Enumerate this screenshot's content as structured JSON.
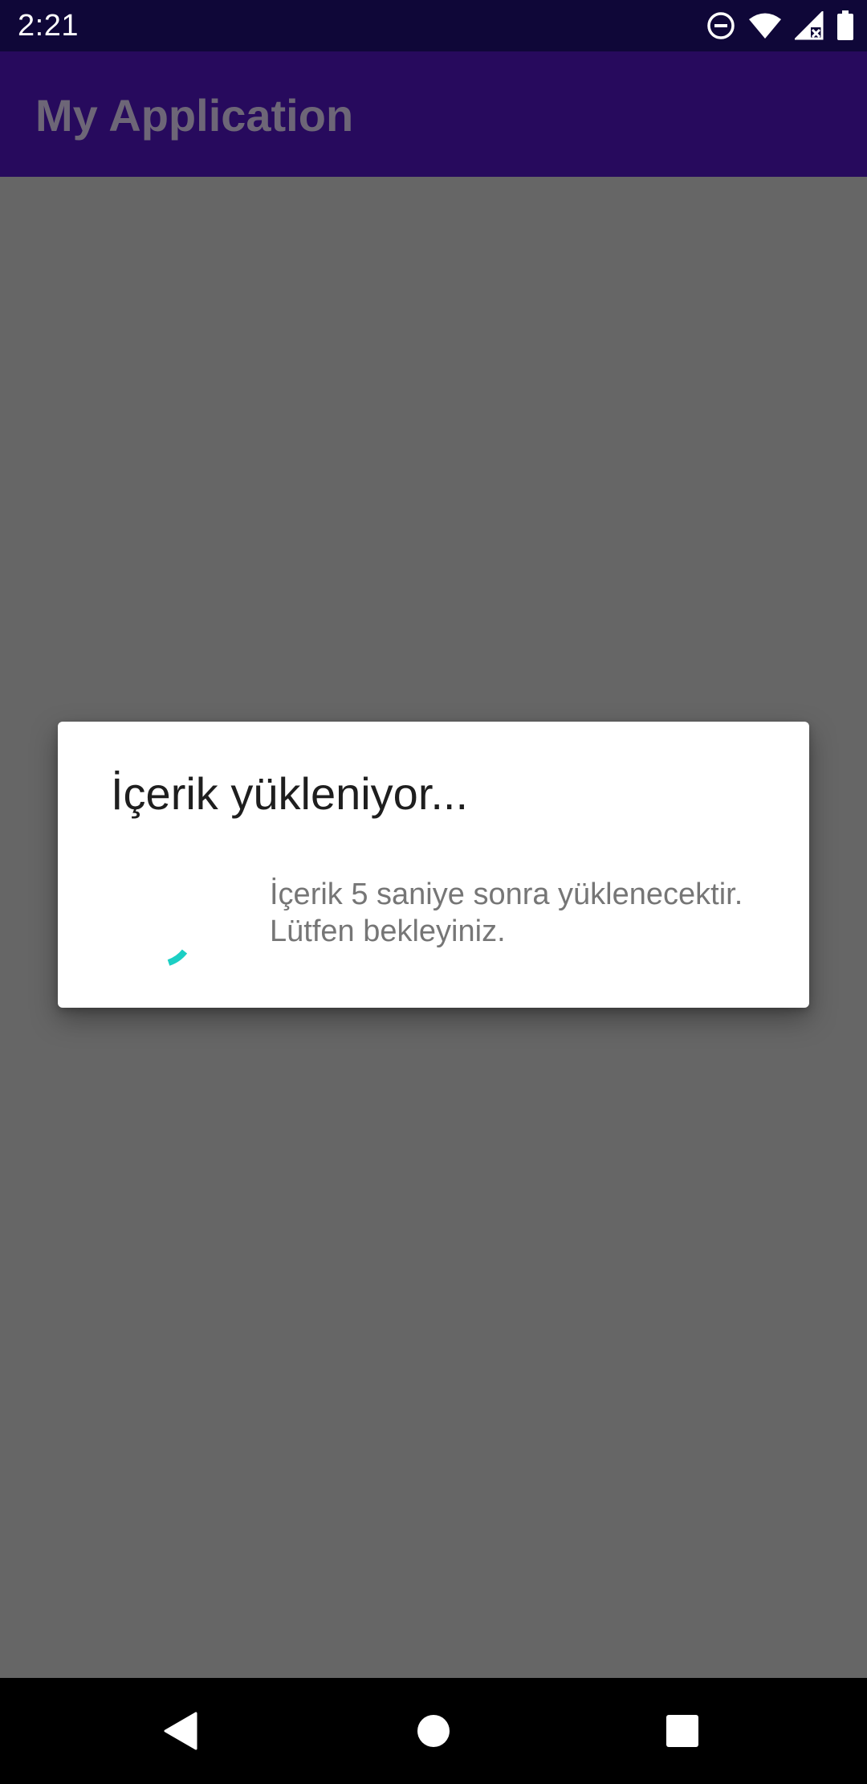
{
  "status_bar": {
    "time": "2:21",
    "icons": [
      "do-not-disturb-icon",
      "wifi-icon",
      "cellular-signal-icon",
      "battery-icon"
    ]
  },
  "app_bar": {
    "title": "My Application"
  },
  "dialog": {
    "title": "İçerik yükleniyor...",
    "message_line1": "İçerik 5 saniye sonra yüklenecektir.",
    "message_line2": "Lütfen bekleyiniz.",
    "spinner_color": "#1ccfc4"
  },
  "nav_bar": {
    "icons": [
      "back-icon",
      "home-icon",
      "recents-icon"
    ]
  },
  "colors": {
    "status_bar": "#0f0738",
    "app_bar": "#270a5d",
    "scrim": "#666666",
    "dialog_background": "#ffffff",
    "nav_bar": "#000000"
  }
}
